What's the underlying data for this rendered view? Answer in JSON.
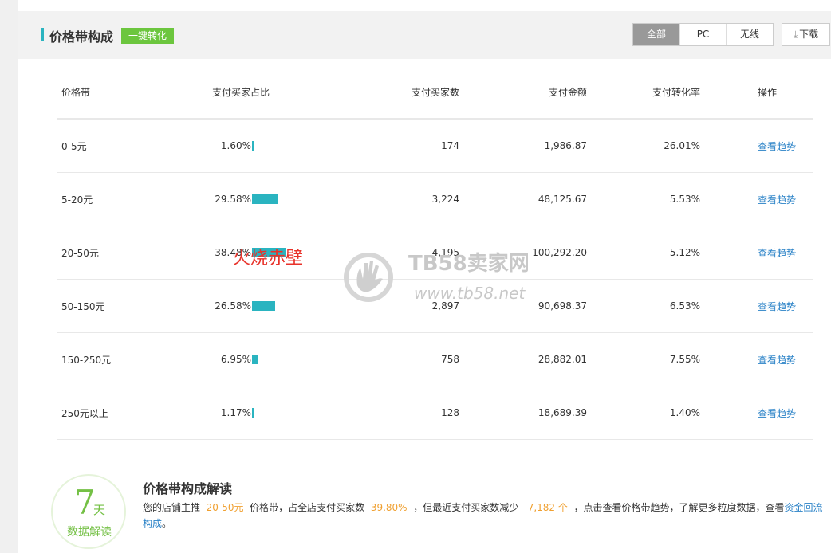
{
  "header": {
    "title": "价格带构成",
    "convert_label": "一键转化",
    "segments": [
      {
        "label": "全部",
        "active": true
      },
      {
        "label": "PC",
        "active": false
      },
      {
        "label": "无线",
        "active": false
      }
    ],
    "download_label": "下载"
  },
  "table": {
    "columns": {
      "price": "价格带",
      "ratio": "支付买家占比",
      "buyers": "支付买家数",
      "amount": "支付金额",
      "rate": "支付转化率",
      "op": "操作"
    },
    "rows": [
      {
        "price": "0-5元",
        "ratio": "1.60%",
        "ratio_value": 1.6,
        "buyers": "174",
        "amount": "1,986.87",
        "rate": "26.01%",
        "op": "查看趋势"
      },
      {
        "price": "5-20元",
        "ratio": "29.58%",
        "ratio_value": 29.58,
        "buyers": "3,224",
        "amount": "48,125.67",
        "rate": "5.53%",
        "op": "查看趋势"
      },
      {
        "price": "20-50元",
        "ratio": "38.48%",
        "ratio_value": 38.48,
        "buyers": "4,195",
        "amount": "100,292.20",
        "rate": "5.12%",
        "op": "查看趋势"
      },
      {
        "price": "50-150元",
        "ratio": "26.58%",
        "ratio_value": 26.58,
        "buyers": "2,897",
        "amount": "90,698.37",
        "rate": "6.53%",
        "op": "查看趋势"
      },
      {
        "price": "150-250元",
        "ratio": "6.95%",
        "ratio_value": 6.95,
        "buyers": "758",
        "amount": "28,882.01",
        "rate": "7.55%",
        "op": "查看趋势"
      },
      {
        "price": "250元以上",
        "ratio": "1.17%",
        "ratio_value": 1.17,
        "buyers": "128",
        "amount": "18,689.39",
        "rate": "1.40%",
        "op": "查看趋势"
      }
    ]
  },
  "analysis": {
    "badge_num": "7",
    "badge_day": "天",
    "badge_sub": "数据解读",
    "title": "价格带构成解读",
    "text_1": "您的店铺主推",
    "hl_1": "20-50元",
    "text_2": "价格带，占全店支付买家数",
    "hl_2": "39.80%",
    "text_3": "，但最近支付买家数减少",
    "hl_3": "7,182 个",
    "text_4": "，点击查看价格带趋势，了解更多粒度数据，查看",
    "link": "资金回流构成",
    "text_5": "。"
  },
  "watermark": {
    "red_text": "火烧赤壁",
    "brand": "TB58卖家网",
    "url": "www.tb58.net"
  },
  "colors": {
    "accent": "#2ab4c0",
    "green": "#6cc63e",
    "link": "#2a82c7",
    "highlight": "#f0a030"
  }
}
